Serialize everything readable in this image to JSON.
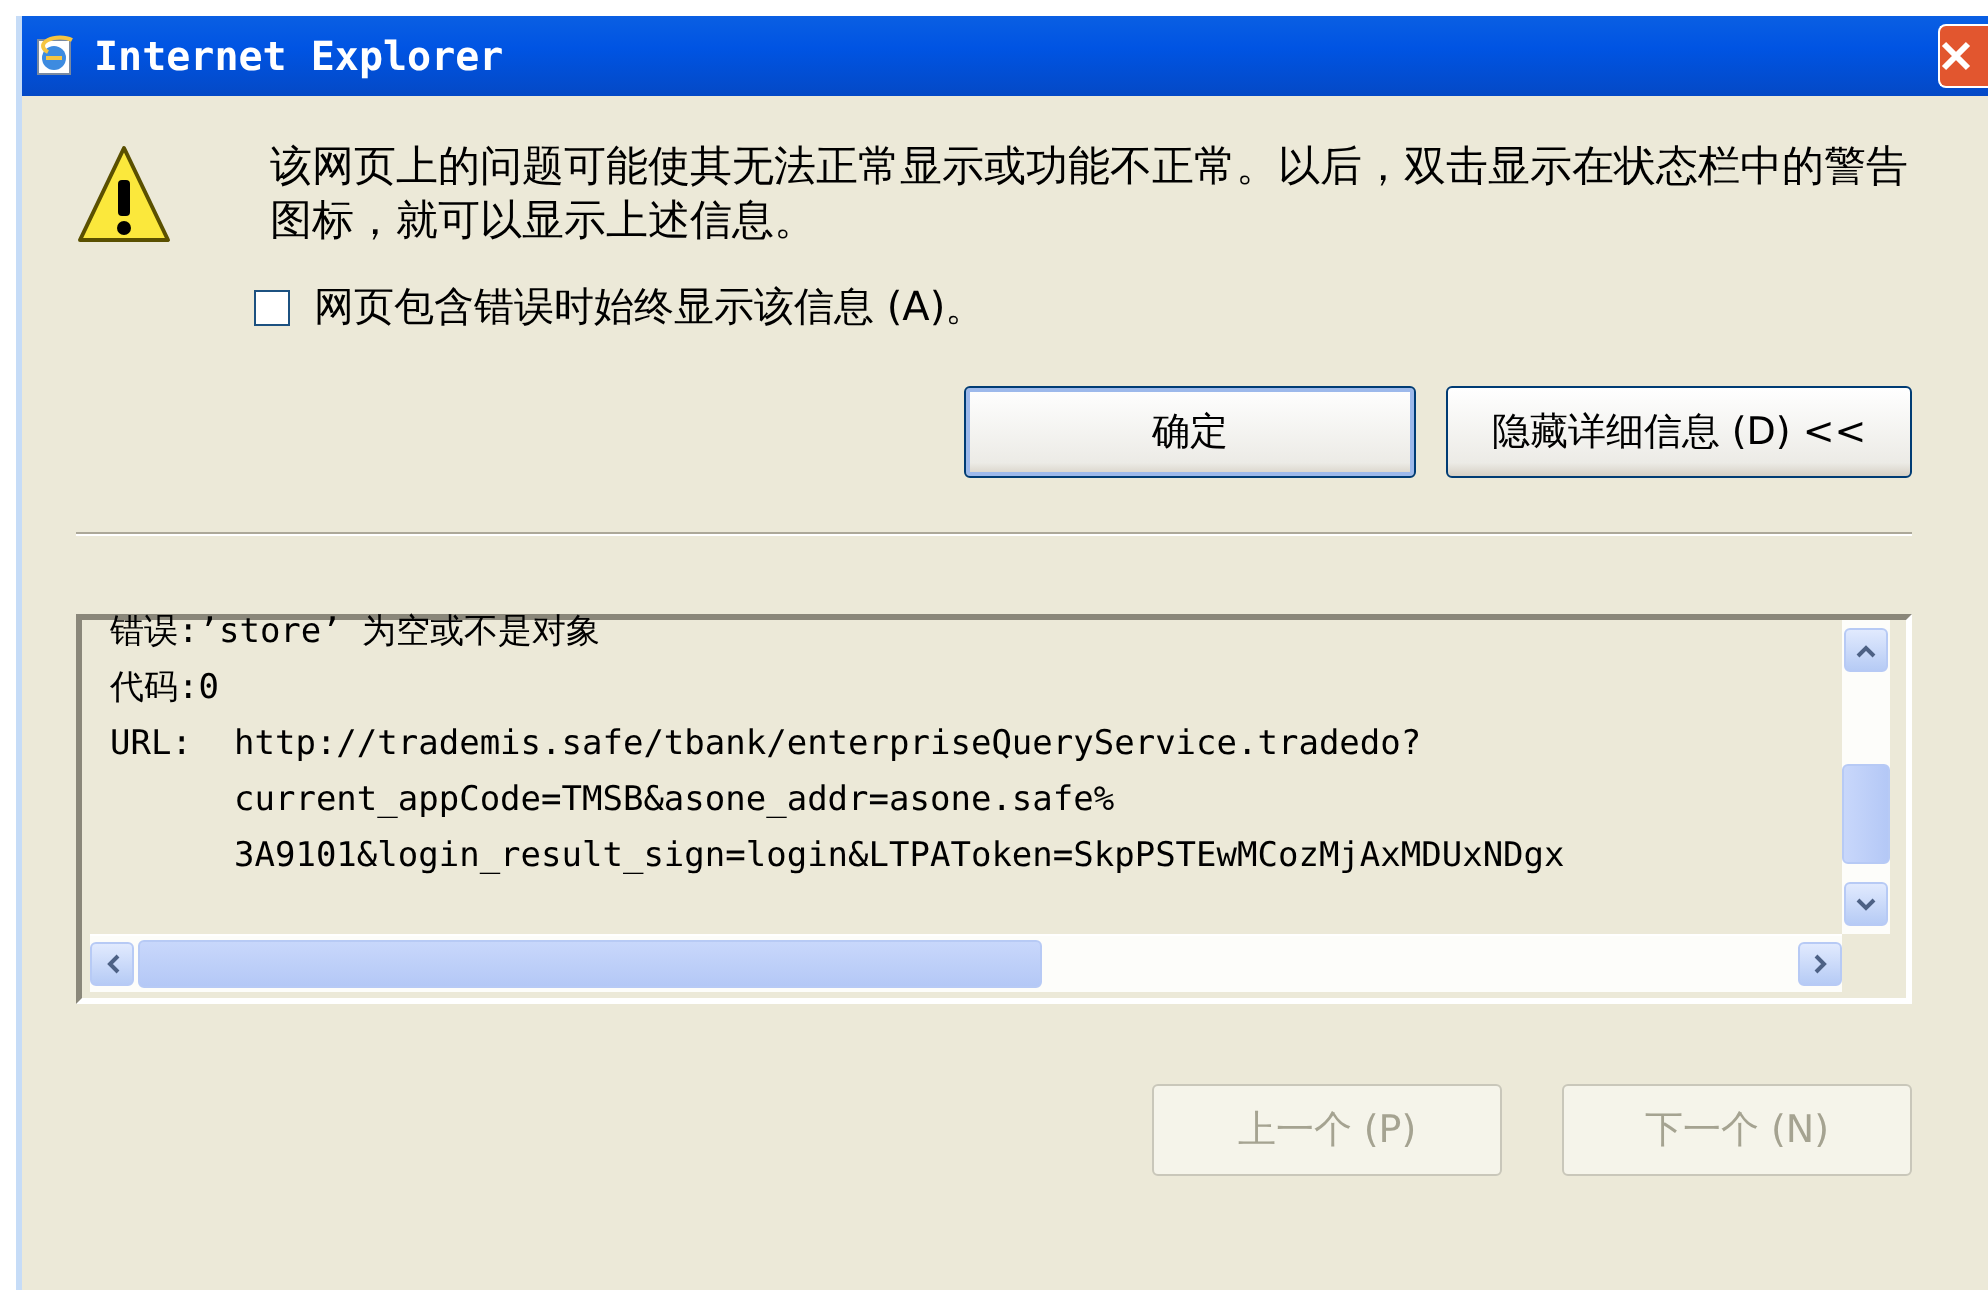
{
  "window": {
    "title": "Internet Explorer"
  },
  "message": "该网页上的问题可能使其无法正常显示或功能不正常。以后，双击显示在状态栏中的警告图标，就可以显示上述信息。",
  "checkbox": {
    "label": "网页包含错误时始终显示该信息 (A)。",
    "checked": false
  },
  "buttons": [
    {
      "label": "确定",
      "kind": "default"
    },
    {
      "label": "隐藏详细信息 (D) <<",
      "kind": "normal"
    }
  ],
  "details": {
    "lines": [
      "错误:’store’ 为空或不是对象",
      "代码:0"
    ],
    "url": {
      "label": "URL:",
      "lines": [
        "http://trademis.safe/tbank/enterpriseQueryService.tradedo?",
        "current_appCode=TMSB&asone_addr=asone.safe%",
        "3A9101&login_result_sign=login&LTPAToken=SkpPSTEwMCozMjAxMDUxNDgx"
      ]
    }
  },
  "nav_buttons": [
    {
      "label": "上一个 (P)",
      "disabled": true
    },
    {
      "label": "下一个 (N)",
      "disabled": true
    }
  ]
}
